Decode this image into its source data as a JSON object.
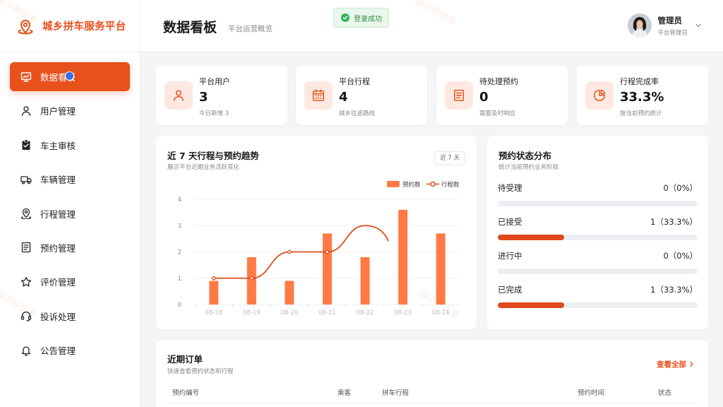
{
  "brand": {
    "title": "城乡拼车服务平台"
  },
  "sidebar": {
    "items": [
      {
        "label": "数据看板",
        "icon": "chart-icon",
        "active": true
      },
      {
        "label": "用户管理",
        "icon": "user-icon"
      },
      {
        "label": "车主审核",
        "icon": "clipboard-check-icon"
      },
      {
        "label": "车辆管理",
        "icon": "truck-icon"
      },
      {
        "label": "行程管理",
        "icon": "map-pin-icon"
      },
      {
        "label": "预约管理",
        "icon": "document-icon"
      },
      {
        "label": "评价管理",
        "icon": "star-icon"
      },
      {
        "label": "投诉处理",
        "icon": "headset-icon"
      },
      {
        "label": "公告管理",
        "icon": "bell-icon"
      }
    ]
  },
  "header": {
    "title": "数据看板",
    "subtitle": "平台运营概览",
    "toast": "登录成功",
    "user": {
      "name": "管理员",
      "role": "平台管理员"
    }
  },
  "stats": [
    {
      "label": "平台用户",
      "value": "3",
      "sub": "今日新增 3",
      "icon": "user-icon"
    },
    {
      "label": "平台行程",
      "value": "4",
      "sub": "城乡往返路线",
      "icon": "calendar-icon"
    },
    {
      "label": "待处理预约",
      "value": "0",
      "sub": "需要及时响应",
      "icon": "document-icon"
    },
    {
      "label": "行程完成率",
      "value": "33.3%",
      "sub": "按当前预约统计",
      "icon": "pie-icon"
    }
  ],
  "trend": {
    "title": "近 7 天行程与预约趋势",
    "subtitle": "展示平台近期业务活跃变化",
    "range": "近 7 天"
  },
  "chart_data": {
    "type": "bar",
    "categories": [
      "08-18",
      "08-19",
      "08-20",
      "08-21",
      "08-22",
      "08-23",
      "08-24"
    ],
    "series": [
      {
        "name": "预约数",
        "type": "bar",
        "values": [
          0.9,
          1.8,
          0.9,
          2.7,
          1.8,
          3.6,
          2.7
        ],
        "color": "#ff7a45"
      },
      {
        "name": "行程数",
        "type": "line",
        "values": [
          1,
          1,
          2,
          2,
          3,
          null,
          null
        ],
        "color": "#e04a1c"
      }
    ],
    "ylim": [
      0,
      4
    ],
    "yticks": [
      0,
      1,
      2,
      3,
      4
    ],
    "grid": true,
    "legend": "top-right"
  },
  "status_dist": {
    "title": "预约状态分布",
    "subtitle": "统计当前预约业务阶段",
    "items": [
      {
        "label": "待受理",
        "value": "0（0%）",
        "ratio": 0
      },
      {
        "label": "已接受",
        "value": "1（33.3%）",
        "ratio": 0.333
      },
      {
        "label": "进行中",
        "value": "0（0%）",
        "ratio": 0
      },
      {
        "label": "已完成",
        "value": "1（33.3%）",
        "ratio": 0.333
      }
    ]
  },
  "orders": {
    "title": "近期订单",
    "subtitle": "快速查看预约状态和行程",
    "view_all": "查看全部",
    "columns": [
      "预约编号",
      "乘客",
      "拼车行程",
      "预约时间",
      "状态"
    ]
  },
  "watermark": "游子好优多"
}
